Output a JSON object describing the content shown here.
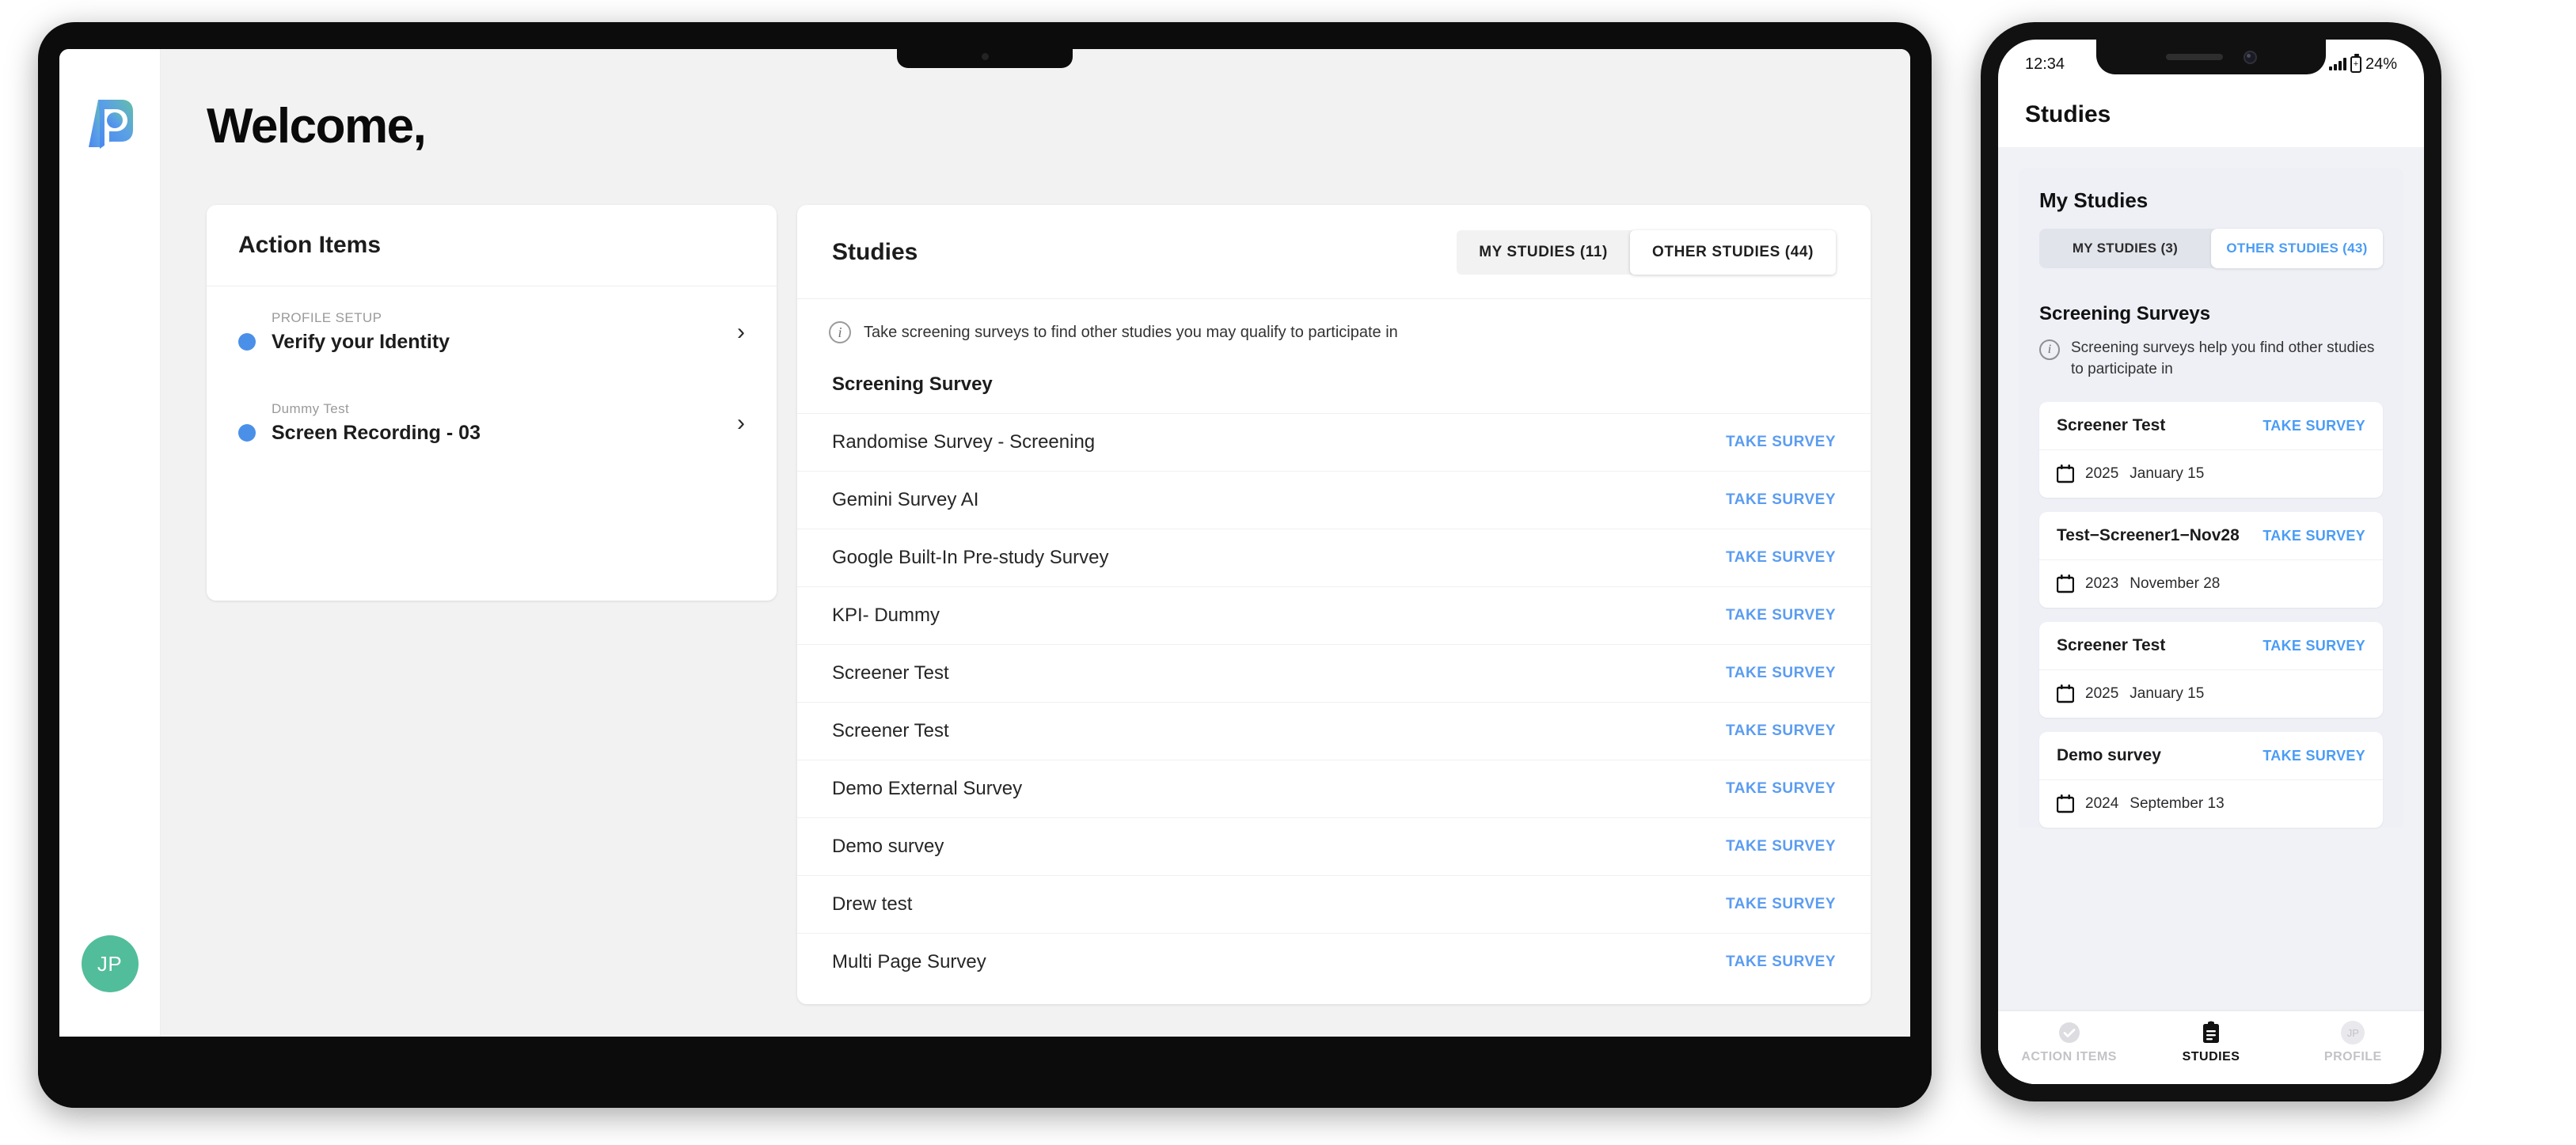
{
  "desktop": {
    "logo_icon": "p-brand-logo",
    "welcome": "Welcome,",
    "avatar_initials": "JP",
    "action_items": {
      "title": "Action Items",
      "items": [
        {
          "category": "PROFILE SETUP",
          "title": "Verify your Identity",
          "chevron": "›"
        },
        {
          "category": "Dummy Test",
          "title": "Screen Recording - 03",
          "chevron": "›"
        }
      ]
    },
    "studies": {
      "title": "Studies",
      "tabs": [
        {
          "label": "MY STUDIES (11)",
          "active": false
        },
        {
          "label": "OTHER STUDIES (44)",
          "active": true
        }
      ],
      "info_text": "Take screening surveys to find other studies you may qualify to participate in",
      "info_icon": "info-circle-icon",
      "section_title": "Screening Survey",
      "action_label": "TAKE SURVEY",
      "rows": [
        {
          "name": "Randomise Survey - Screening"
        },
        {
          "name": "Gemini Survey AI"
        },
        {
          "name": "Google Built-In Pre-study Survey"
        },
        {
          "name": "KPI- Dummy"
        },
        {
          "name": "Screener Test"
        },
        {
          "name": "Screener Test"
        },
        {
          "name": "Demo External Survey"
        },
        {
          "name": "Demo survey"
        },
        {
          "name": "Drew test"
        },
        {
          "name": "Multi Page Survey"
        }
      ]
    }
  },
  "phone": {
    "status": {
      "time": "12:34",
      "battery": "24%",
      "signal_icon": "signal-bars-icon",
      "battery_icon": "battery-icon"
    },
    "header_title": "Studies",
    "my_studies_title": "My Studies",
    "tabs": [
      {
        "label": "MY STUDIES (3)",
        "active": false
      },
      {
        "label": "OTHER STUDIES (43)",
        "active": true
      }
    ],
    "screening": {
      "title": "Screening Surveys",
      "info_text": "Screening surveys help you find other studies to participate in",
      "info_icon": "info-circle-icon"
    },
    "action_label": "TAKE SURVEY",
    "calendar_icon": "calendar-icon",
    "cards": [
      {
        "title": "Screener Test",
        "year": "2025",
        "date": "January 15"
      },
      {
        "title": "Test−Screener1−Nov28",
        "year": "2023",
        "date": "November 28"
      },
      {
        "title": "Screener Test",
        "year": "2025",
        "date": "January 15"
      },
      {
        "title": "Demo survey",
        "year": "2024",
        "date": "September 13"
      }
    ],
    "tabbar": [
      {
        "label": "ACTION ITEMS",
        "icon": "check-circle-icon",
        "active": false
      },
      {
        "label": "STUDIES",
        "icon": "clipboard-icon",
        "active": true
      },
      {
        "label": "PROFILE",
        "icon": "avatar-icon",
        "initials": "JP",
        "active": false
      }
    ]
  },
  "colors": {
    "accent_blue": "#5b9cf0",
    "dot_blue": "#4a90e8",
    "avatar_green": "#52bd9a",
    "phone_link_blue": "#4a9cf5"
  }
}
